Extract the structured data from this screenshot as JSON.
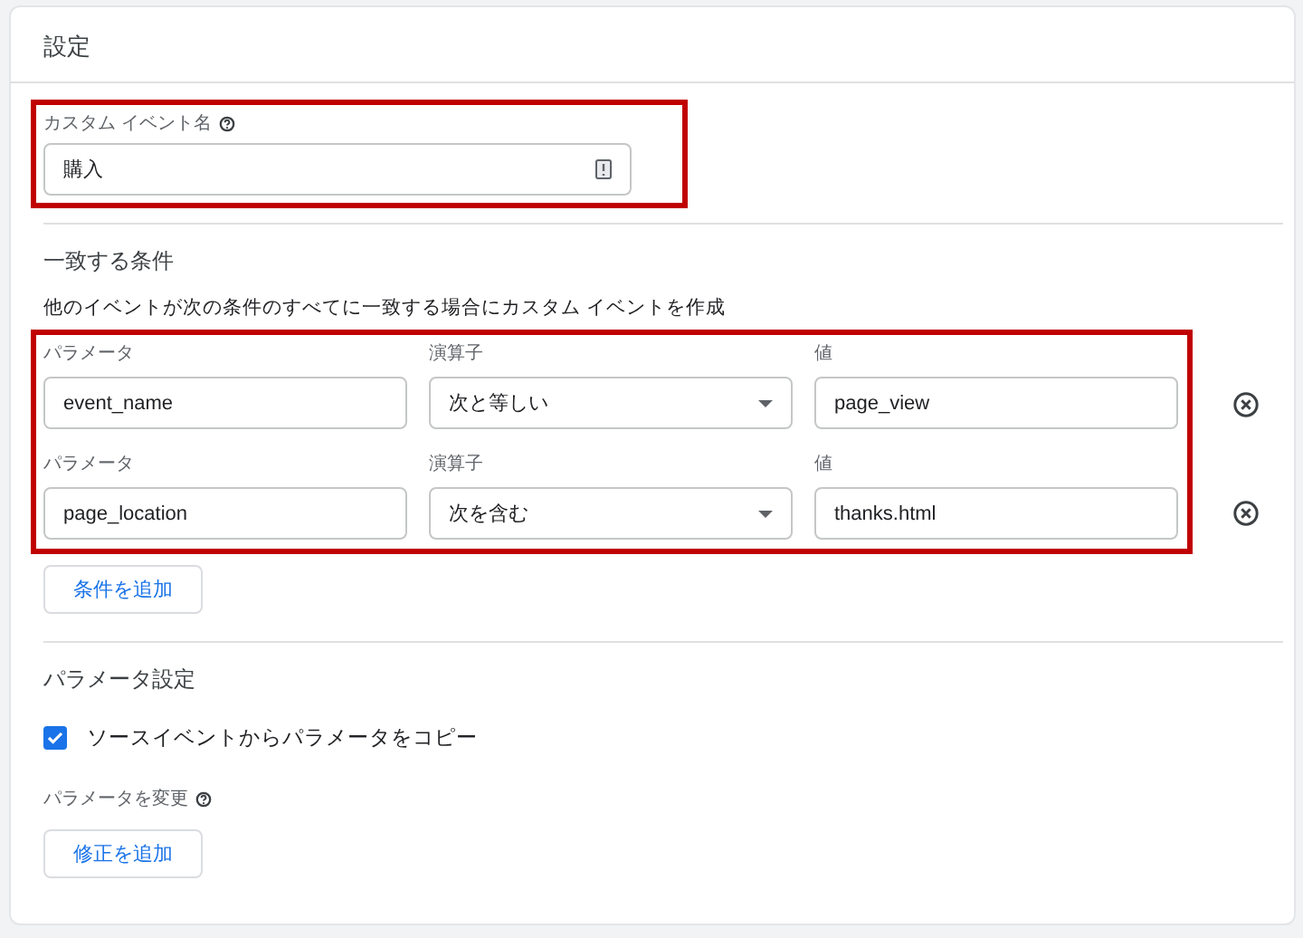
{
  "title": "設定",
  "custom_event": {
    "label": "カスタム イベント名",
    "value": "購入",
    "highlighted": true
  },
  "conditions": {
    "heading": "一致する条件",
    "description": "他のイベントが次の条件のすべてに一致する場合にカスタム イベントを作成",
    "highlighted": true,
    "rows": [
      {
        "parameter_label": "パラメータ",
        "parameter": "event_name",
        "operator_label": "演算子",
        "operator": "次と等しい",
        "value_label": "値",
        "value": "page_view"
      },
      {
        "parameter_label": "パラメータ",
        "parameter": "page_location",
        "operator_label": "演算子",
        "operator": "次を含む",
        "value_label": "値",
        "value": "thanks.html"
      }
    ],
    "add_button": "条件を追加"
  },
  "parameter_settings": {
    "heading": "パラメータ設定",
    "copy_checkbox": {
      "label": "ソースイベントからパラメータをコピー",
      "checked": true
    },
    "modify_label": "パラメータを変更",
    "add_button": "修正を追加"
  }
}
